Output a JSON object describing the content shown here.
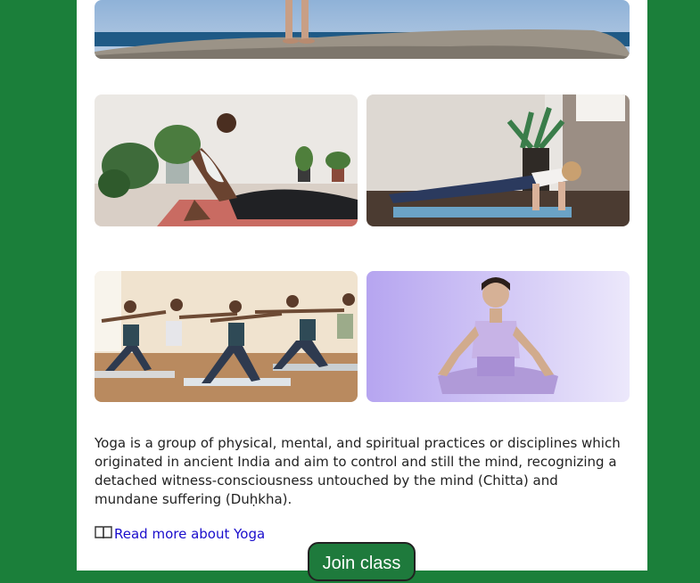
{
  "description": "Yoga is a group of physical, mental, and spiritual practices or disciplines which originated in ancient India and aim to control and still the mind, recognizing a detached witness-consciousness untouched by the mind (Chitta) and mundane suffering (Duḥkha).",
  "read_more_label": "Read more about Yoga",
  "join_button_label": "Join class",
  "colors": {
    "background": "#1b7f3a",
    "button": "#1e7a3c",
    "link": "#1a0dcc"
  },
  "icons": {
    "read_more": "book-icon"
  }
}
